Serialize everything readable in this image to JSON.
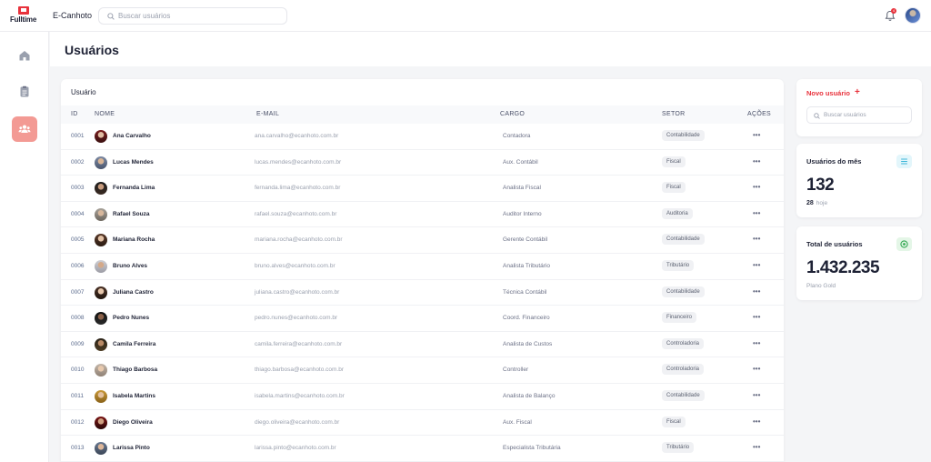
{
  "brand": {
    "logo_text": "Fulltime",
    "app_name": "E-Canhoto",
    "accent": "#e8323c"
  },
  "search": {
    "placeholder": "Buscar usuários"
  },
  "notifications": {
    "count": "4"
  },
  "page": {
    "title": "Usuários"
  },
  "table": {
    "title": "Usuário",
    "columns": [
      "ID",
      "NOME",
      "E-MAIL",
      "CARGO",
      "SETOR",
      "AÇÕES"
    ],
    "more_icon": "•••",
    "rows": [
      {
        "id": "0001",
        "name": "Ana Carvalho",
        "email": "ana.carvalho@ecanhoto.com.br",
        "cargo": "Contadora",
        "setor": "Contabilidade"
      },
      {
        "id": "0002",
        "name": "Lucas Mendes",
        "email": "lucas.mendes@ecanhoto.com.br",
        "cargo": "Aux. Contábil",
        "setor": "Fiscal"
      },
      {
        "id": "0003",
        "name": "Fernanda Lima",
        "email": "fernanda.lima@ecanhoto.com.br",
        "cargo": "Analista Fiscal",
        "setor": "Fiscal"
      },
      {
        "id": "0004",
        "name": "Rafael Souza",
        "email": "rafael.souza@ecanhoto.com.br",
        "cargo": "Auditor Interno",
        "setor": "Auditoria"
      },
      {
        "id": "0005",
        "name": "Mariana Rocha",
        "email": "mariana.rocha@ecanhoto.com.br",
        "cargo": "Gerente Contábil",
        "setor": "Contabilidade"
      },
      {
        "id": "0006",
        "name": "Bruno Alves",
        "email": "bruno.alves@ecanhoto.com.br",
        "cargo": "Analista Tributário",
        "setor": "Tributário"
      },
      {
        "id": "0007",
        "name": "Juliana Castro",
        "email": "juliana.castro@ecanhoto.com.br",
        "cargo": "Técnica Contábil",
        "setor": "Contabilidade"
      },
      {
        "id": "0008",
        "name": "Pedro Nunes",
        "email": "pedro.nunes@ecanhoto.com.br",
        "cargo": "Coord. Financeiro",
        "setor": "Financeiro"
      },
      {
        "id": "0009",
        "name": "Camila Ferreira",
        "email": "camila.ferreira@ecanhoto.com.br",
        "cargo": "Analista de Custos",
        "setor": "Controladoria"
      },
      {
        "id": "0010",
        "name": "Thiago Barbosa",
        "email": "thiago.barbosa@ecanhoto.com.br",
        "cargo": "Controller",
        "setor": "Controladoria"
      },
      {
        "id": "0011",
        "name": "Isabela Martins",
        "email": "isabela.martins@ecanhoto.com.br",
        "cargo": "Analista de Balanço",
        "setor": "Contabilidade"
      },
      {
        "id": "0012",
        "name": "Diego Oliveira",
        "email": "diego.oliveira@ecanhoto.com.br",
        "cargo": "Aux. Fiscal",
        "setor": "Fiscal"
      },
      {
        "id": "0013",
        "name": "Larissa Pinto",
        "email": "larissa.pinto@ecanhoto.com.br",
        "cargo": "Especialista Tributária",
        "setor": "Tributário"
      }
    ]
  },
  "new_user": {
    "label": "Novo usuário",
    "plus": "+",
    "search_placeholder": "Buscar usuários"
  },
  "stats": {
    "month": {
      "title": "Usuários do mês",
      "value": "132",
      "today_value": "28",
      "today_label": "hoje",
      "icon": "list-icon",
      "icon_color": "#e3f6fb"
    },
    "total": {
      "title": "Total de usuários",
      "value": "1.432.235",
      "sub": "Plano Gold",
      "icon": "badge-icon",
      "icon_color": "#e4f6e7"
    }
  }
}
